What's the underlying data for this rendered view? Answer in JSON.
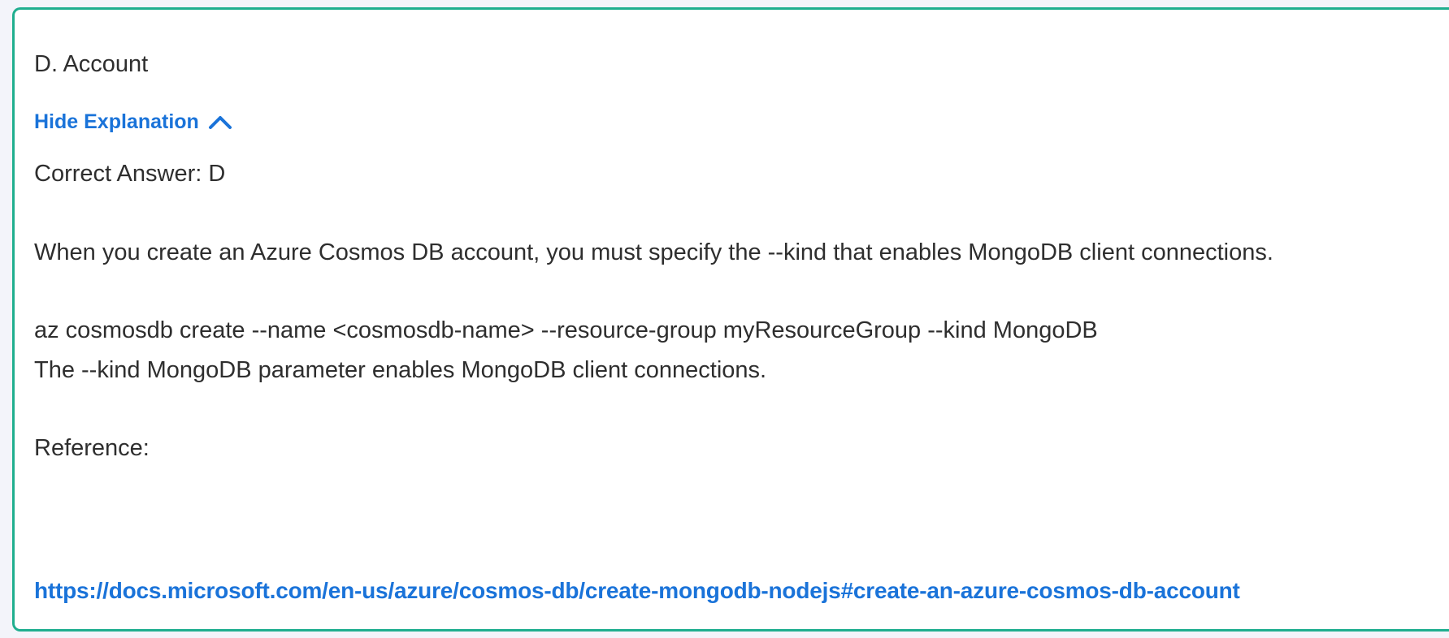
{
  "option": {
    "label": "D. Account"
  },
  "explanation": {
    "toggle_label": "Hide Explanation",
    "toggle_icon": "chevron-up-icon",
    "correct_answer": "Correct Answer: D",
    "paragraph": "When you create an Azure Cosmos DB account, you must specify the --kind that enables MongoDB client connections.",
    "command": "az cosmosdb create --name <cosmosdb-name> --resource-group myResourceGroup --kind MongoDB",
    "command_note": "The --kind MongoDB parameter enables MongoDB client connections.",
    "reference_label": "Reference:",
    "reference_url": "https://docs.microsoft.com/en-us/azure/cosmos-db/create-mongodb-nodejs#create-an-azure-cosmos-db-account"
  },
  "colors": {
    "border": "#1fae8f",
    "link": "#1a73d9",
    "text": "#2e2e2e",
    "page_background": "#f3f4fa"
  }
}
